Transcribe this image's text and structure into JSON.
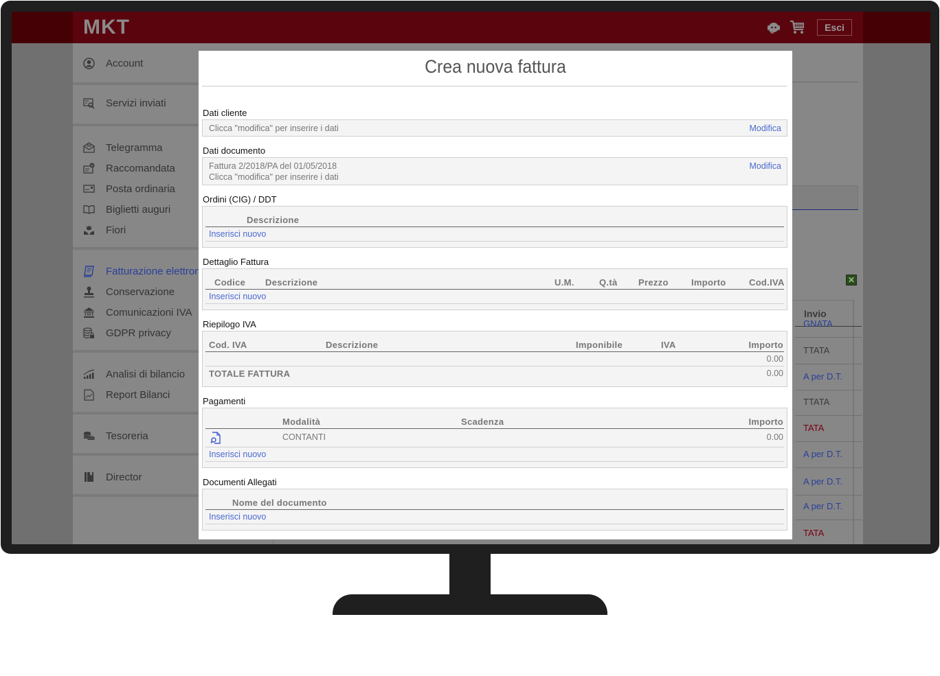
{
  "app": {
    "logo": "MKT",
    "header": {
      "support_icon": "headset-support-icon",
      "cart_icon": "shopping-cart-icon",
      "logout_label": "Esci"
    }
  },
  "sidebar": {
    "groups": [
      {
        "items": [
          {
            "label": "Account",
            "icon": "user-circle-icon"
          }
        ]
      },
      {
        "items": [
          {
            "label": "Servizi inviati",
            "icon": "search-document-icon"
          }
        ]
      },
      {
        "items": [
          {
            "label": "Telegramma",
            "icon": "envelope-open-icon"
          },
          {
            "label": "Raccomandata",
            "icon": "envelope-check-icon"
          },
          {
            "label": "Posta ordinaria",
            "icon": "postcard-icon"
          },
          {
            "label": "Biglietti auguri",
            "icon": "open-book-icon"
          },
          {
            "label": "Fiori",
            "icon": "flower-icon"
          }
        ]
      },
      {
        "items": [
          {
            "label": "Fatturazione elettronica",
            "icon": "invoice-icon",
            "active": true
          },
          {
            "label": "Conservazione",
            "icon": "stamp-icon"
          },
          {
            "label": "Comunicazioni IVA",
            "icon": "bank-icon"
          },
          {
            "label": "GDPR privacy",
            "icon": "database-lock-icon"
          }
        ]
      },
      {
        "items": [
          {
            "label": "Analisi di bilancio",
            "icon": "bar-chart-icon"
          },
          {
            "label": "Report Bilanci",
            "icon": "report-chart-icon"
          }
        ]
      },
      {
        "items": [
          {
            "label": "Tesoreria",
            "icon": "coins-icon"
          }
        ]
      },
      {
        "items": [
          {
            "label": "Director",
            "icon": "binder-icon"
          }
        ]
      }
    ]
  },
  "background_table": {
    "column_header": "Invio",
    "rows": [
      {
        "text": "GNATA",
        "color": "blue"
      },
      {
        "text": "TTATA",
        "color": "gray"
      },
      {
        "text": "A per D.T.",
        "color": "blue"
      },
      {
        "text": "TTATA",
        "color": "gray"
      },
      {
        "text": "TATA",
        "color": "red"
      },
      {
        "text": "A per D.T.",
        "color": "blue"
      },
      {
        "text": "A per D.T.",
        "color": "blue"
      },
      {
        "text": "A per D.T.",
        "color": "blue"
      },
      {
        "text": "TATA",
        "color": "red"
      }
    ],
    "export_icon": "excel-export-icon"
  },
  "modal": {
    "title": "Crea nuova fattura",
    "dati_cliente": {
      "label": "Dati cliente",
      "text": "Clicca \"modifica\" per inserire i dati",
      "edit_label": "Modifica"
    },
    "dati_documento": {
      "label": "Dati documento",
      "line1": "Fattura 2/2018/PA del 01/05/2018",
      "line2": "Clicca \"modifica\" per inserire i dati",
      "edit_label": "Modifica"
    },
    "ordini": {
      "label": "Ordini (CIG) / DDT",
      "columns": [
        "Descrizione"
      ],
      "add_label": "Inserisci nuovo"
    },
    "dettaglio": {
      "label": "Dettaglio Fattura",
      "columns": [
        "Codice",
        "Descrizione",
        "U.M.",
        "Q.tà",
        "Prezzo",
        "Importo",
        "Cod.IVA"
      ],
      "add_label": "Inserisci nuovo"
    },
    "riepilogo": {
      "label": "Riepilogo IVA",
      "columns": [
        "Cod. IVA",
        "Descrizione",
        "Imponibile",
        "IVA",
        "Importo"
      ],
      "row_importo": "0.00",
      "total_label": "TOTALE FATTURA",
      "total_value": "0.00"
    },
    "pagamenti": {
      "label": "Pagamenti",
      "columns": [
        "Modalità",
        "Scadenza",
        "Importo"
      ],
      "rows": [
        {
          "modalita": "CONTANTI",
          "scadenza": "",
          "importo": "0.00",
          "icon": "view-document-icon"
        }
      ],
      "add_label": "Inserisci nuovo"
    },
    "allegati": {
      "label": "Documenti Allegati",
      "columns": [
        "Nome del documento"
      ],
      "add_label": "Inserisci nuovo"
    }
  }
}
